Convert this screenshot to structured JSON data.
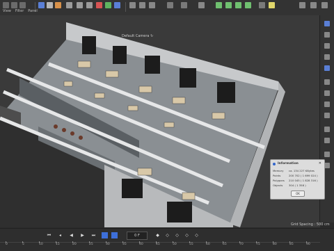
{
  "menu": {
    "items": [
      "View",
      "Filter",
      "Panel"
    ]
  },
  "viewport": {
    "camera_label": "Default Camera ↻",
    "grid_spacing": "Grid Spacing : 500 cm"
  },
  "info_dialog": {
    "title": "Information",
    "rows": [
      {
        "label": "Memory",
        "value": "ca. 134 227 KBytes"
      },
      {
        "label": "Points",
        "value": "200 702 ( 1 699 024 )"
      },
      {
        "label": "Polygons",
        "value": "210 045 ( 1 828 316 )"
      },
      {
        "label": "Objects",
        "value": "304 ( 1 358 )"
      }
    ],
    "ok_label": "OK"
  },
  "timeline": {
    "current_frame": "0 F",
    "ruler_ticks": [
      "0",
      "5",
      "10",
      "15",
      "20",
      "25",
      "30",
      "35",
      "40",
      "45",
      "50",
      "55",
      "60",
      "65",
      "70",
      "75",
      "80",
      "85",
      "90"
    ]
  },
  "colors": {
    "accent": "#3d6fd9",
    "toolbar": "#333333",
    "viewport": "#3a3a3a",
    "floor": "#8a8f93"
  }
}
